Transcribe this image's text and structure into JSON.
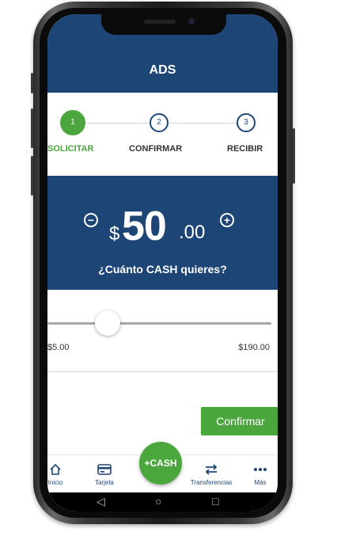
{
  "app": {
    "title": "ADS"
  },
  "steps": [
    {
      "number": "1",
      "label": "SOLICITAR",
      "active": true
    },
    {
      "number": "2",
      "label": "CONFIRMAR",
      "active": false
    },
    {
      "number": "3",
      "label": "RECIBIR",
      "active": false
    }
  ],
  "amount": {
    "currency": "$",
    "whole": "50",
    "decimals": ".00",
    "prompt": "¿Cuánto CASH quieres?",
    "decrease_symbol": "−",
    "increase_symbol": "+"
  },
  "slider": {
    "min_label": "$5.00",
    "max_label": "$190.00",
    "value": 50,
    "min": 5,
    "max": 190
  },
  "confirm": {
    "label": "Confirmar"
  },
  "nav": {
    "items": [
      {
        "label": "Inicio",
        "icon": "home-icon"
      },
      {
        "label": "Tarjeta",
        "icon": "card-icon"
      },
      {
        "label": "Transferencias",
        "icon": "transfer-icon"
      },
      {
        "label": "Más",
        "icon": "more-icon"
      }
    ],
    "fab_label": "+CASH"
  },
  "colors": {
    "brand": "#1d4677",
    "accent": "#4ca63e"
  }
}
